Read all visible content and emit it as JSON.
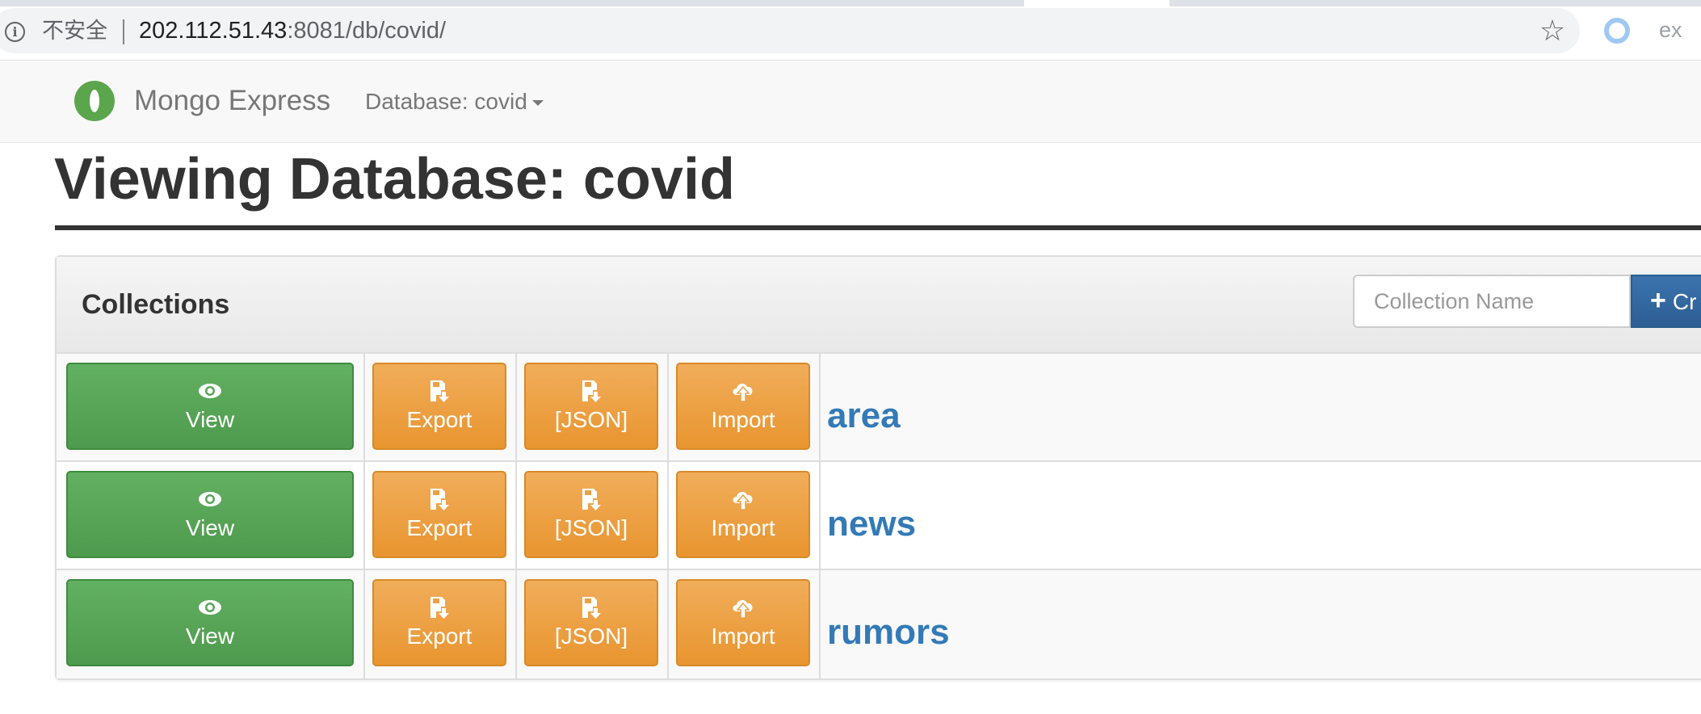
{
  "browser": {
    "security_label": "不安全",
    "url_host": "202.112.51.43",
    "url_rest": ":8081/db/covid/",
    "extension_text": "ex"
  },
  "navbar": {
    "brand": "Mongo Express",
    "database_menu": "Database: covid"
  },
  "page": {
    "title": "Viewing Database: covid"
  },
  "collections_panel": {
    "heading": "Collections",
    "name_placeholder": "Collection Name",
    "create_label": "Cr",
    "rows": [
      {
        "name": "area",
        "view": "View",
        "export": "Export",
        "json": "[JSON]",
        "import": "Import"
      },
      {
        "name": "news",
        "view": "View",
        "export": "Export",
        "json": "[JSON]",
        "import": "Import"
      },
      {
        "name": "rumors",
        "view": "View",
        "export": "Export",
        "json": "[JSON]",
        "import": "Import"
      }
    ]
  },
  "colors": {
    "view_button": "#5cb85c",
    "orange_button": "#f0ad4e",
    "primary_button": "#337ab7",
    "link": "#337ab7",
    "logo_green": "#5ba64d"
  },
  "icons": {
    "view": "eye-icon",
    "export": "floppy-download-icon",
    "json": "floppy-download-icon",
    "import": "cloud-upload-icon",
    "create": "plus-icon"
  }
}
